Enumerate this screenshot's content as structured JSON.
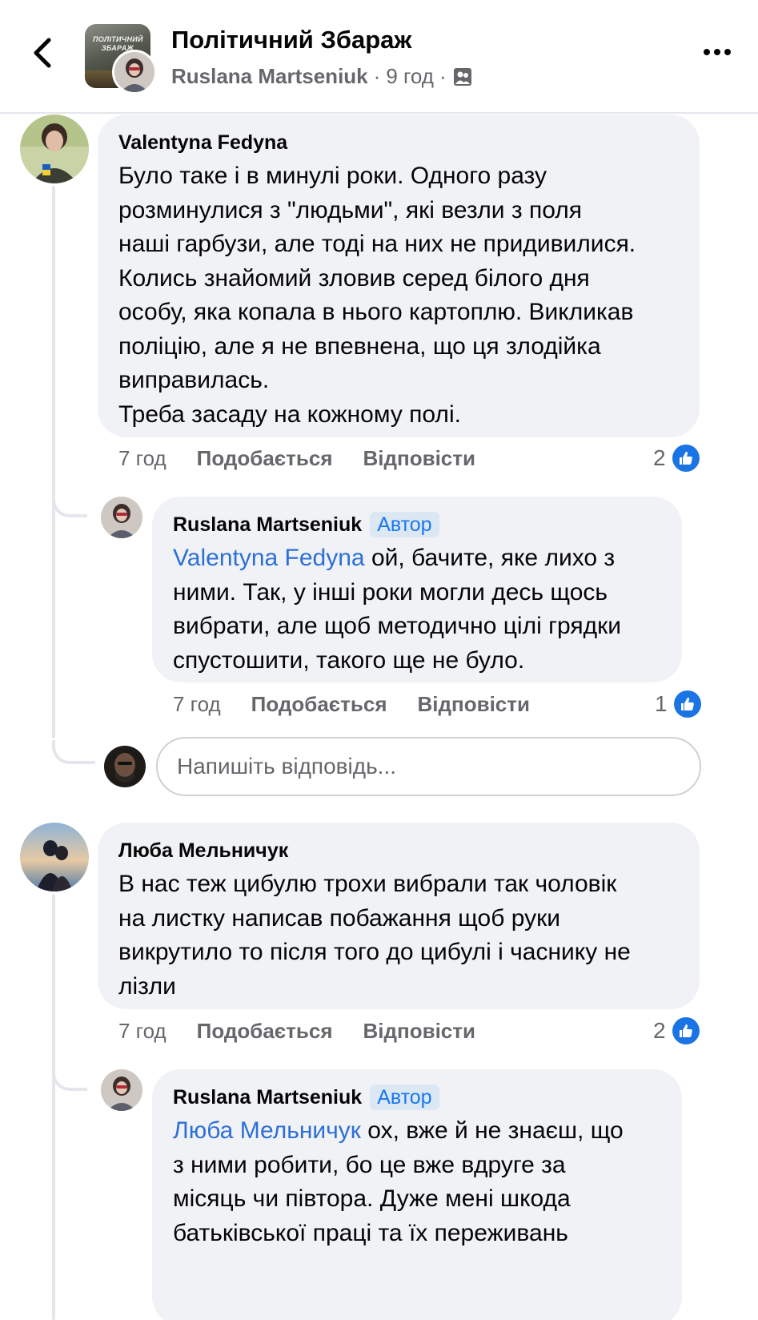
{
  "header": {
    "back_icon": "chevron-left-icon",
    "group_thumb_text": "ПОЛІТИЧНИЙ ЗБАРАЖ",
    "title": "Політичний Збараж",
    "post_author": "Ruslana Martseniuk",
    "separator1": "·",
    "post_time": "9 год",
    "separator2": "·",
    "audience_icon": "group-audience-icon",
    "more_icon": "more-dots-icon"
  },
  "comments": [
    {
      "author": "Valentyna Fedyna",
      "text": "Було таке і в минулі роки. Одного разу\nрозминулися з \"людьми\", які везли з поля\nнаші гарбузи, але тоді на них не придивилися.\nКолись знайомий зловив серед білого дня\nособу, яка копала в нього картоплю. Викликав\nполіцію, але я не впевнена, що ця злодійка\nвиправилась.\nТреба засаду на кожному полі.",
      "time": "7 год",
      "like_label": "Подобається",
      "reply_label": "Відповісти",
      "reactions": "2",
      "reply": {
        "author": "Ruslana Martseniuk",
        "badge": "Автор",
        "mention": "Valentyna Fedyna",
        "text": " ой, бачите, яке лихо з\nними. Так, у інші роки могли десь щось\nвибрати, але щоб методично цілі грядки\nспустошити, такого ще не було.",
        "time": "7 год",
        "like_label": "Подобається",
        "reply_label": "Відповісти",
        "reactions": "1"
      }
    },
    {
      "author": "Люба Мельничук",
      "text": "В нас теж цибулю трохи вибрали так чоловік\nна листку написав побажання щоб руки\nвикрутило то після того до цибулі і часнику не\nлізли",
      "time": "7 год",
      "like_label": "Подобається",
      "reply_label": "Відповісти",
      "reactions": "2",
      "reply": {
        "author": "Ruslana Martseniuk",
        "badge": "Автор",
        "mention": "Люба Мельничук",
        "text": " ох, вже й не знаєш, що\nз ними робити, бо це вже вдруге за\nмісяць чи півтора. Дуже мені шкода\nбатьківської праці та їх переживань"
      }
    }
  ],
  "reply_box": {
    "placeholder": "Напишіть відповідь..."
  },
  "colors": {
    "bubble": "#f0f2f5",
    "accent": "#1877f2",
    "mention": "#2d6fd6",
    "meta": "#65676b"
  }
}
